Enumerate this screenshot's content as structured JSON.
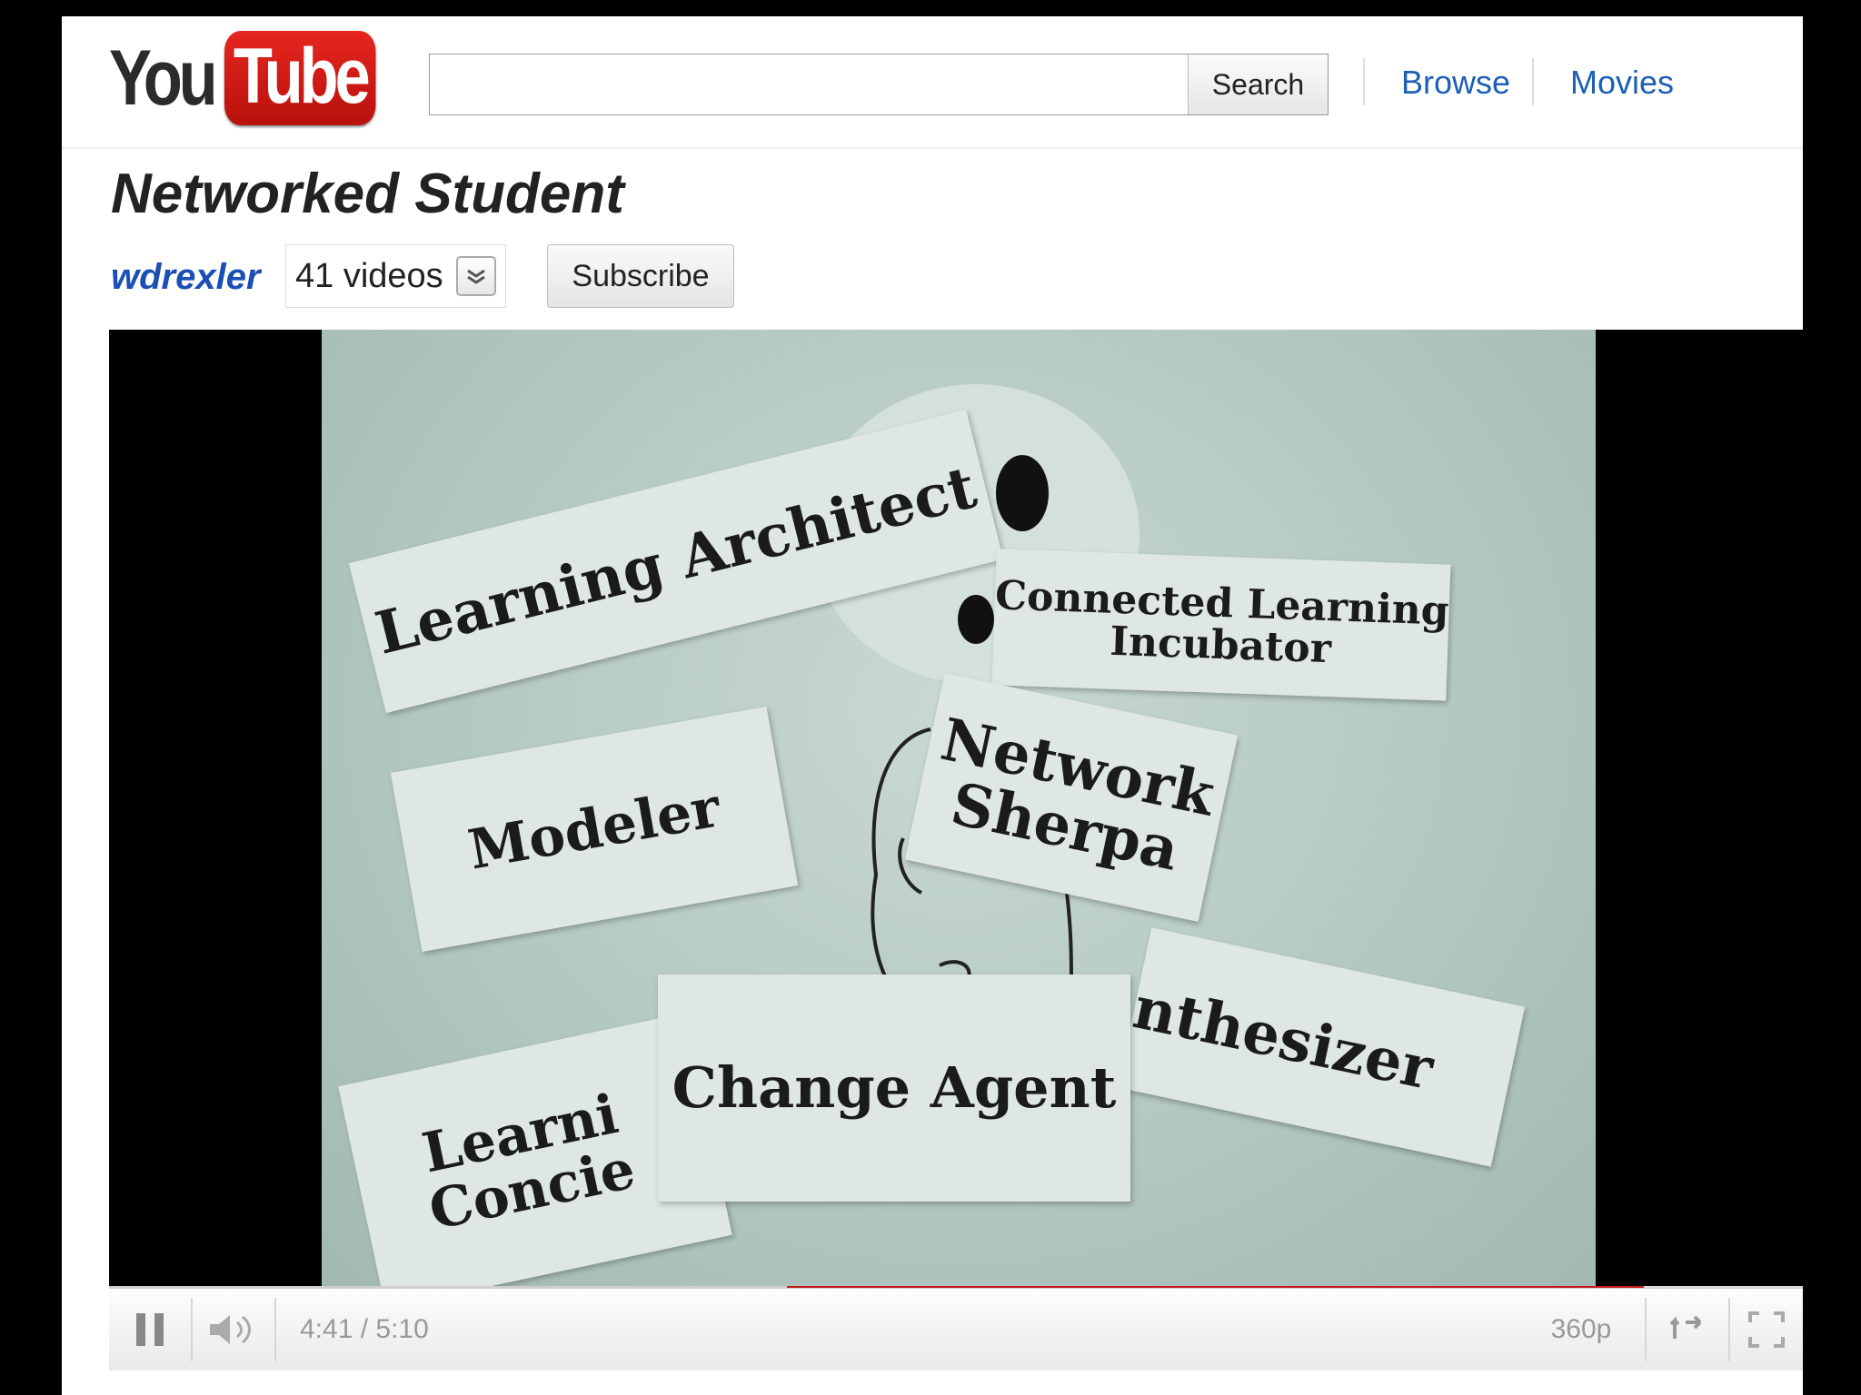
{
  "header": {
    "logo_you": "You",
    "logo_tube": "Tube",
    "search_placeholder": "",
    "search_button": "Search",
    "nav": [
      "Browse",
      "Movies"
    ]
  },
  "video": {
    "title": "Networked Student",
    "channel": "wdrexler",
    "videos_count": "41 videos",
    "subscribe_label": "Subscribe"
  },
  "frame_cards": {
    "learning_architect": "Learning Architect",
    "connected": "Connected Learning Incubator",
    "network_sherpa": "Network Sherpa",
    "modeler": "Modeler",
    "change_agent": "Change Agent",
    "synthesizer": "nthesizer",
    "learning_concierge": "Learni Concie"
  },
  "player": {
    "time_current": "4:41",
    "time_total": "5:10",
    "time_display": "4:41 / 5:10",
    "quality": "360p",
    "progress_fraction": 0.906,
    "buffer_fraction": 0.4,
    "play_state": "playing",
    "accent_color": "#c41b1b"
  },
  "icons": [
    "pause-icon",
    "volume-icon",
    "popout-icon",
    "fullscreen-icon",
    "chevron-down-icon"
  ]
}
